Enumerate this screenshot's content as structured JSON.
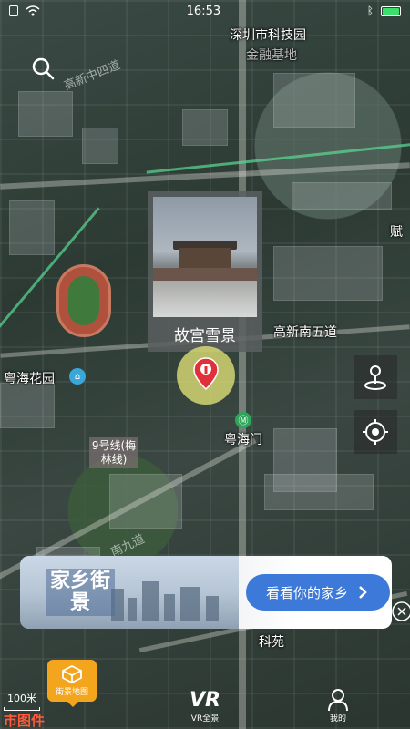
{
  "status_bar": {
    "time": "16:53"
  },
  "map": {
    "labels": {
      "keji_yuan": "深圳市科技园",
      "jinrong": "金融基地",
      "zhongsi": "高新中四道",
      "nanwu": "高新南五道",
      "yuehai_garden": "粤海花园",
      "yuehai_gate": "粤海门",
      "line9": "9号线(梅林线)",
      "nanjiu": "南九道",
      "keyuan": "科苑",
      "fu": "赋"
    },
    "photo_card": {
      "title": "故宫雪景"
    }
  },
  "banner": {
    "logo_text": "家乡街景",
    "cta_label": "看看你的家乡"
  },
  "scale": {
    "text": "100米"
  },
  "brand": {
    "text": "市图件"
  },
  "bottom_nav": {
    "items": [
      {
        "label": "街景地图",
        "icon": "street-map-icon"
      },
      {
        "label": "VR全景",
        "icon": "vr-icon"
      },
      {
        "label": "我的",
        "icon": "user-icon"
      }
    ]
  },
  "colors": {
    "accent": "#f4a51e",
    "cta": "#3d79d8",
    "pin": "#e0313a"
  }
}
